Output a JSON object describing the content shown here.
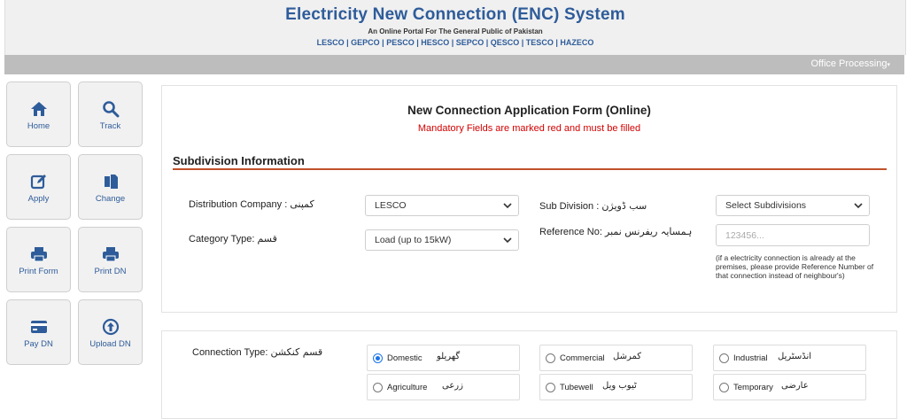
{
  "header": {
    "title": "Electricity New Connection (ENC) System",
    "subtitle": "An Online Portal For The General Public of Pakistan",
    "companies": "LESCO | GEPCO | PESCO | HESCO | SEPCO | QESCO | TESCO | HAZECO"
  },
  "menubar": {
    "office_processing": "Office Processing"
  },
  "sidenav": {
    "items": [
      {
        "label": "Home",
        "icon": "home-icon"
      },
      {
        "label": "Track",
        "icon": "search-icon"
      },
      {
        "label": "Apply",
        "icon": "edit-icon"
      },
      {
        "label": "Change",
        "icon": "copy-icon"
      },
      {
        "label": "Print Form",
        "icon": "print-icon"
      },
      {
        "label": "Print DN",
        "icon": "print-icon"
      },
      {
        "label": "Pay DN",
        "icon": "card-icon"
      },
      {
        "label": "Upload DN",
        "icon": "upload-icon"
      }
    ]
  },
  "form": {
    "title": "New Connection Application Form (Online)",
    "mandatory_note": "Mandatory Fields are marked red and must be filled",
    "section_title": "Subdivision Information",
    "distribution_company_label": "Distribution Company :",
    "distribution_company_urdu": "کمپنی",
    "distribution_company_value": "LESCO",
    "category_type_label": "Category Type:",
    "category_type_urdu": "قسم",
    "category_type_value": "Load (up to 15kW)",
    "sub_division_label": "Sub Division :",
    "sub_division_urdu": "سب ڈویژن",
    "sub_division_value": "Select Subdivisions",
    "reference_no_label": "Reference No:",
    "reference_no_urdu": "ہمسایہ ریفرنس نمبر",
    "reference_no_placeholder": "123456...",
    "reference_hint": "(if a electricity connection is already at the premises, please provide Reference Number of that connection instead of neighbour's)"
  },
  "connection": {
    "label": "Connection Type:",
    "label_urdu": "قسم کنکشن",
    "options": [
      {
        "label": "Domestic",
        "urdu": "گھریلو",
        "checked": true
      },
      {
        "label": "Commercial",
        "urdu": "کمرشل",
        "checked": false
      },
      {
        "label": "Industrial",
        "urdu": "انڈسٹریل",
        "checked": false
      },
      {
        "label": "Agriculture",
        "urdu": "زرعی",
        "checked": false
      },
      {
        "label": "Tubewell",
        "urdu": "ٹیوب ویل",
        "checked": false
      },
      {
        "label": "Temporary",
        "urdu": "عارضی",
        "checked": false
      }
    ]
  },
  "colors": {
    "brand_blue": "#2e5c9a",
    "mandatory_red": "#d10000",
    "section_rule": "#c0522b"
  }
}
